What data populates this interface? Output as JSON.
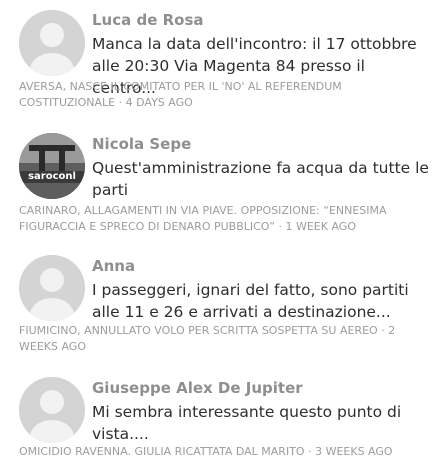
{
  "comments": [
    {
      "author": "Luca de Rosa",
      "text": "Manca la data dell'incontro: il 17 ottobbre alle 20:30 Via Magenta 84 presso il centro...",
      "article": "AVERSA, NASCE IL COMITATO PER IL 'NO' AL REFERENDUM COSTITUZIONALE",
      "separator": "·",
      "time": "4 DAYS AGO",
      "avatar": "default-avatar"
    },
    {
      "author": "Nicola Sepe",
      "text": "Quest'amministrazione fa acqua da tutte le parti",
      "article": "CARINARO, ALLAGAMENTI IN VIA PIAVE. OPPOSIZIONE: “ENNESIMA FIGURACCIA E SPRECO DI DENARO PUBBLICO”",
      "separator": "·",
      "time": "1 WEEK AGO",
      "avatar": "photo-avatar",
      "avatar_text": "saroconl"
    },
    {
      "author": "Anna",
      "text": "I passeggeri, ignari del fatto, sono partiti alle 11 e 26 e arrivati a destinazione...",
      "article": "FIUMICINO, ANNULLATO VOLO PER SCRITTA SOSPETTA SU AEREO",
      "separator": "·",
      "time": "2 WEEKS AGO",
      "avatar": "default-avatar"
    },
    {
      "author": "Giuseppe Alex De Jupiter",
      "text": "Mi sembra interessante questo punto di vista....",
      "article": "OMICIDIO RAVENNA. GIULIA RICATTATA DAL MARITO",
      "separator": "·",
      "time": "3 WEEKS AGO",
      "avatar": "default-avatar"
    }
  ]
}
